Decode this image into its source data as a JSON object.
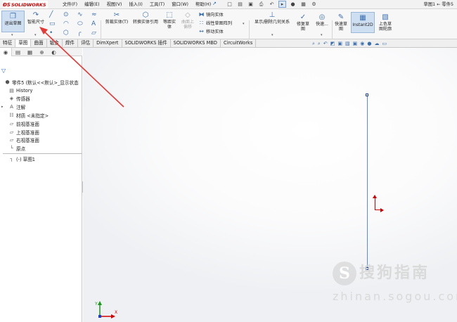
{
  "app": {
    "logo_ds": "ĐS",
    "logo_text": "SOLIDWORKS",
    "menus": [
      "文件(F)",
      "编辑(E)",
      "视图(V)",
      "插入(I)",
      "工具(T)",
      "窗口(W)",
      "帮助(H)"
    ],
    "doc_title": "草图1 ← 零件5"
  },
  "ribbon": {
    "exit_sketch": "退出草图",
    "smart_dim": "智能尺寸",
    "trim": "剪裁实体(T)",
    "convert": "转换实体引用",
    "offset": "等距实\n体",
    "surface_offset": "曲面上\n偏移",
    "mirror": "镜向实体",
    "linear_pattern": "线性草图阵列",
    "move": "移动实体",
    "relations": "显示/删除几何关系",
    "repair": "修复草\n图",
    "quick_snaps": "快速...",
    "rapid_sketch": "快速草\n图",
    "instant2d": "Instant2D",
    "shaded_sketch": "上色草\n图轮廓"
  },
  "tabs": [
    "特征",
    "草图",
    "曲面",
    "钣金",
    "焊件",
    "评估",
    "DimXpert",
    "SOLIDWORKS 插件",
    "SOLIDWORKS MBD",
    "CircuitWorks"
  ],
  "tree": {
    "root": "零件5 (默认<<默认>_显示状态",
    "items": [
      "History",
      "传感器",
      "注解",
      "材质 <未指定>",
      "前视基准面",
      "上视基准面",
      "右视基准面",
      "原点"
    ],
    "sketch": "(-) 草图1"
  },
  "watermark": {
    "logo_char": "S",
    "text": "搜狗指南",
    "url": "zhinan.sogou.com"
  },
  "triad": {
    "x": "X",
    "y": "Y"
  }
}
